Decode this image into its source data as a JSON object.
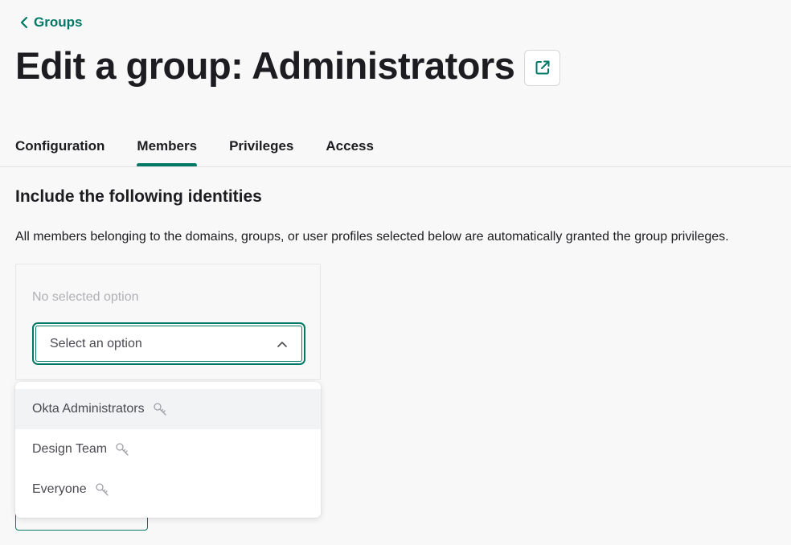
{
  "breadcrumb": {
    "back_label": "Groups"
  },
  "header": {
    "title": "Edit a group: Administrators"
  },
  "tabs": [
    {
      "label": "Configuration",
      "active": false
    },
    {
      "label": "Members",
      "active": true
    },
    {
      "label": "Privileges",
      "active": false
    },
    {
      "label": "Access",
      "active": false
    }
  ],
  "section": {
    "heading": "Include the following identities",
    "description": "All members belonging to the domains, groups, or user profiles selected below are automatically granted the group privileges."
  },
  "selector": {
    "empty_text": "No selected option",
    "placeholder": "Select an option",
    "options": [
      {
        "label": "Okta Administrators",
        "icon": "key-icon",
        "highlighted": true
      },
      {
        "label": "Design Team",
        "icon": "key-icon",
        "highlighted": false
      },
      {
        "label": "Everyone",
        "icon": "key-icon",
        "highlighted": false
      }
    ]
  },
  "colors": {
    "accent": "#007866",
    "text": "#1d1d21",
    "muted": "#b0b0b6"
  }
}
